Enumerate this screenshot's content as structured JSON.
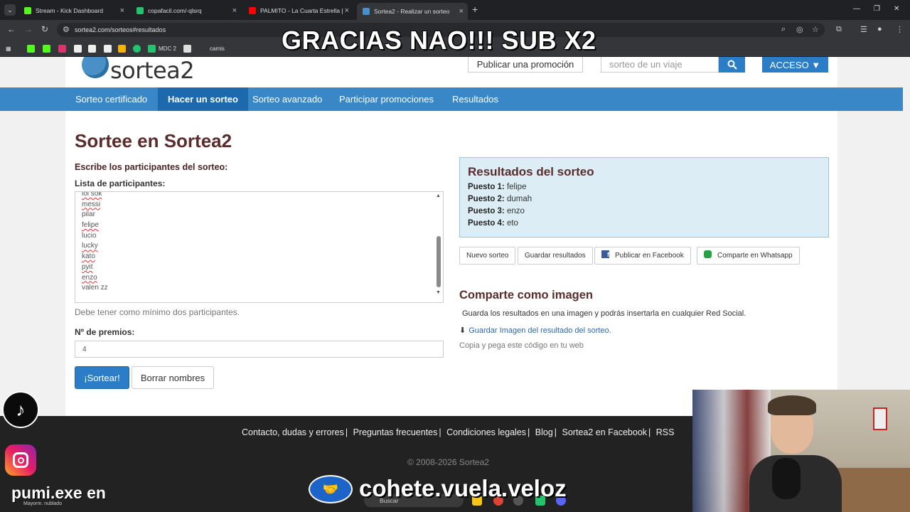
{
  "browser": {
    "tabs": [
      {
        "title": "Stream - Kick Dashboard",
        "color": "#53fc18"
      },
      {
        "title": "copafacil.com/-qlsrq",
        "color": "#21c36f"
      },
      {
        "title": "PALMITO - La Cuarta Estrella [V",
        "color": "#ff0000"
      },
      {
        "title": "Sortea2 - Realizar un sorteo",
        "color": "#4a90c8"
      }
    ],
    "url": "sortea2.com/sorteos#resultados",
    "bookmarks": [
      "MDC 2",
      "camis"
    ]
  },
  "overlay": {
    "title": "GRACIAS NAO!!! SUB X2",
    "pumi": "pumi.exe en",
    "cohete": "cohete.vuela.veloz",
    "weather": "Mayorm. nublado",
    "search": "Buscar"
  },
  "header": {
    "logo": "sortea2",
    "promo_button": "Publicar una promoción",
    "search_placeholder": "sorteo de un viaje",
    "acceso": "ACCESO ▼"
  },
  "nav": {
    "items": [
      {
        "label": "Sorteo certificado"
      },
      {
        "label": "Hacer un sorteo"
      },
      {
        "label": "Sorteo avanzado"
      },
      {
        "label": "Participar promociones"
      },
      {
        "label": "Resultados"
      }
    ]
  },
  "main": {
    "title": "Sortee en Sortea2",
    "subtitle": "Escribe los participantes del sorteo:",
    "list_label": "Lista de participantes:",
    "participants": [
      "lol sok",
      "messi",
      "pilar",
      "felipe",
      "lucio",
      "lucky",
      "kato",
      "pyit",
      "enzo",
      "valen zz"
    ],
    "hint": "Debe tener como mínimo dos participantes.",
    "prizes_label": "Nº de premios:",
    "prizes_value": "4",
    "draw_button": "¡Sortear!",
    "clear_button": "Borrar nombres"
  },
  "results": {
    "title": "Resultados del sorteo",
    "rows": [
      {
        "label": "Puesto 1:",
        "value": "felipe"
      },
      {
        "label": "Puesto 2:",
        "value": "dumah"
      },
      {
        "label": "Puesto 3:",
        "value": "enzo"
      },
      {
        "label": "Puesto 4:",
        "value": "eto"
      }
    ],
    "buttons": {
      "new": "Nuevo sorteo",
      "save": "Guardar resultados",
      "facebook": "Publicar en Facebook",
      "whatsapp": "Comparte en Whatsapp"
    }
  },
  "share": {
    "title": "Comparte como imagen",
    "text": "Guarda los resultados en una imagen y podrás insertarla en cualquier Red Social.",
    "link": "Guardar Imagen del resultado del sorteo.",
    "embed": "Copia y pega este código en tu web"
  },
  "footer": {
    "links": [
      "Contacto, dudas y errores",
      "Preguntas frecuentes",
      "Condiciones legales",
      "Blog",
      "Sortea2 en Facebook",
      "RSS"
    ],
    "copyright": "© 2008-2026 Sortea2"
  },
  "colors": {
    "accent": "#2a7dc6",
    "heading": "#5b2c2c",
    "navbar": "#3a87c8"
  }
}
